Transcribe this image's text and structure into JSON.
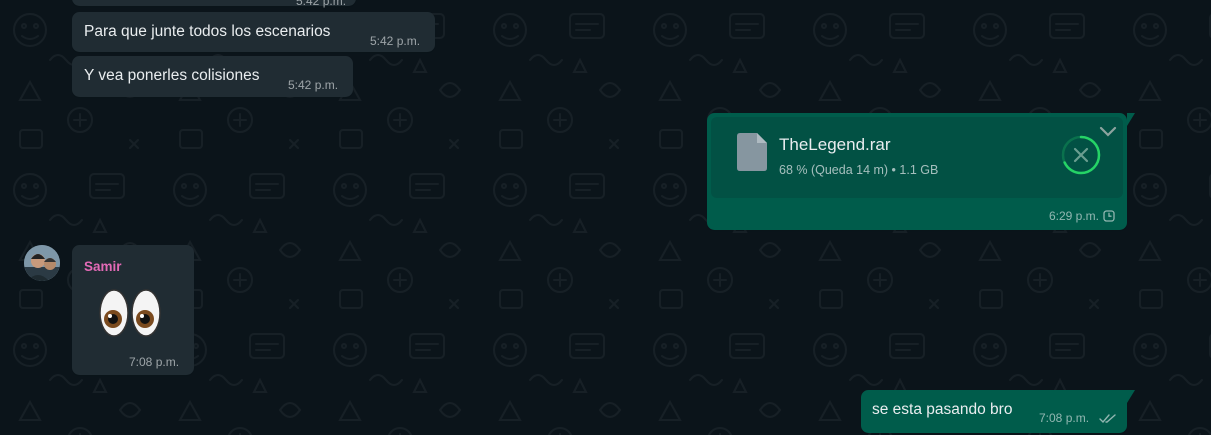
{
  "messages": {
    "clipped": {
      "time": "5:42 p.m."
    },
    "m1": {
      "text": "Para que junte todos los escenarios",
      "time": "5:42 p.m."
    },
    "m2": {
      "text": "Y vea ponerles colisiones",
      "time": "5:42 p.m."
    },
    "file": {
      "name": "TheLegend.rar",
      "meta": "68 % (Queda 14 m) • 1.1 GB",
      "progress": 0.68,
      "time": "6:29 p.m.",
      "status_icon": "clock-icon"
    },
    "sticker": {
      "sender": "Samir",
      "emoji": "👀",
      "time": "7:08 p.m."
    },
    "out": {
      "text": "se esta pasando bro",
      "time": "7:08 p.m.",
      "status_icon": "double-check-icon"
    }
  },
  "colors": {
    "background": "#0b141a",
    "incoming": "#202c33",
    "outgoing": "#005c4b",
    "sender_name": "#e26ab6",
    "cancel_ring": "#25d366"
  }
}
